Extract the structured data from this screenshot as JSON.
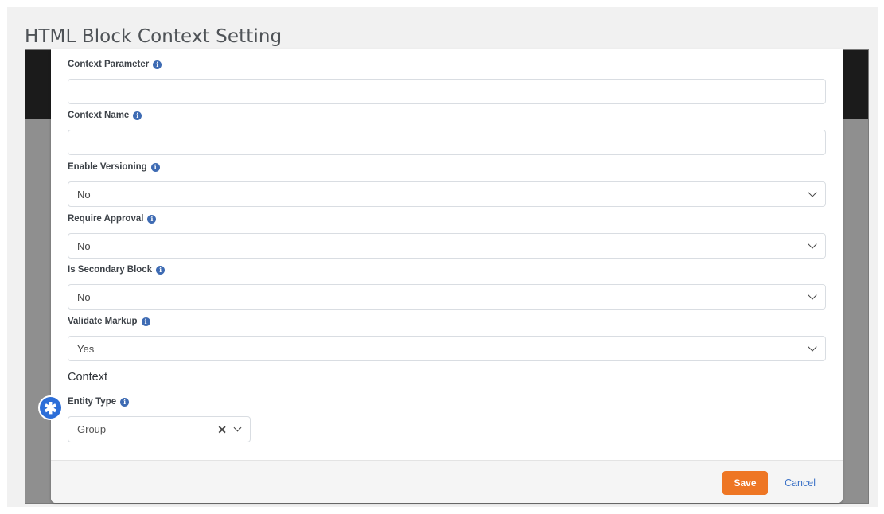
{
  "page_title": "HTML Block Context Setting",
  "fields": [
    {
      "label": "Context Parameter",
      "value": ""
    },
    {
      "label": "Context Name",
      "value": ""
    },
    {
      "label": "Enable Versioning",
      "value": "No"
    },
    {
      "label": "Require Approval",
      "value": "No"
    },
    {
      "label": "Is Secondary Block",
      "value": "No"
    },
    {
      "label": "Validate Markup",
      "value": "Yes"
    }
  ],
  "context": {
    "section_title": "Context",
    "entity_type": {
      "label": "Entity Type",
      "value": "Group"
    }
  },
  "icons": {
    "info": "info-circle-icon",
    "marker": "asterisk-marker-icon",
    "clear": "x-icon",
    "dropdown": "chevron-down-icon"
  },
  "footer": {
    "save_label": "Save",
    "cancel_label": "Cancel"
  },
  "colors": {
    "accent_orange": "#ee7624",
    "link_blue": "#3d73c7",
    "info_blue": "#3e6bb3",
    "marker_blue": "#2c6ed8"
  }
}
